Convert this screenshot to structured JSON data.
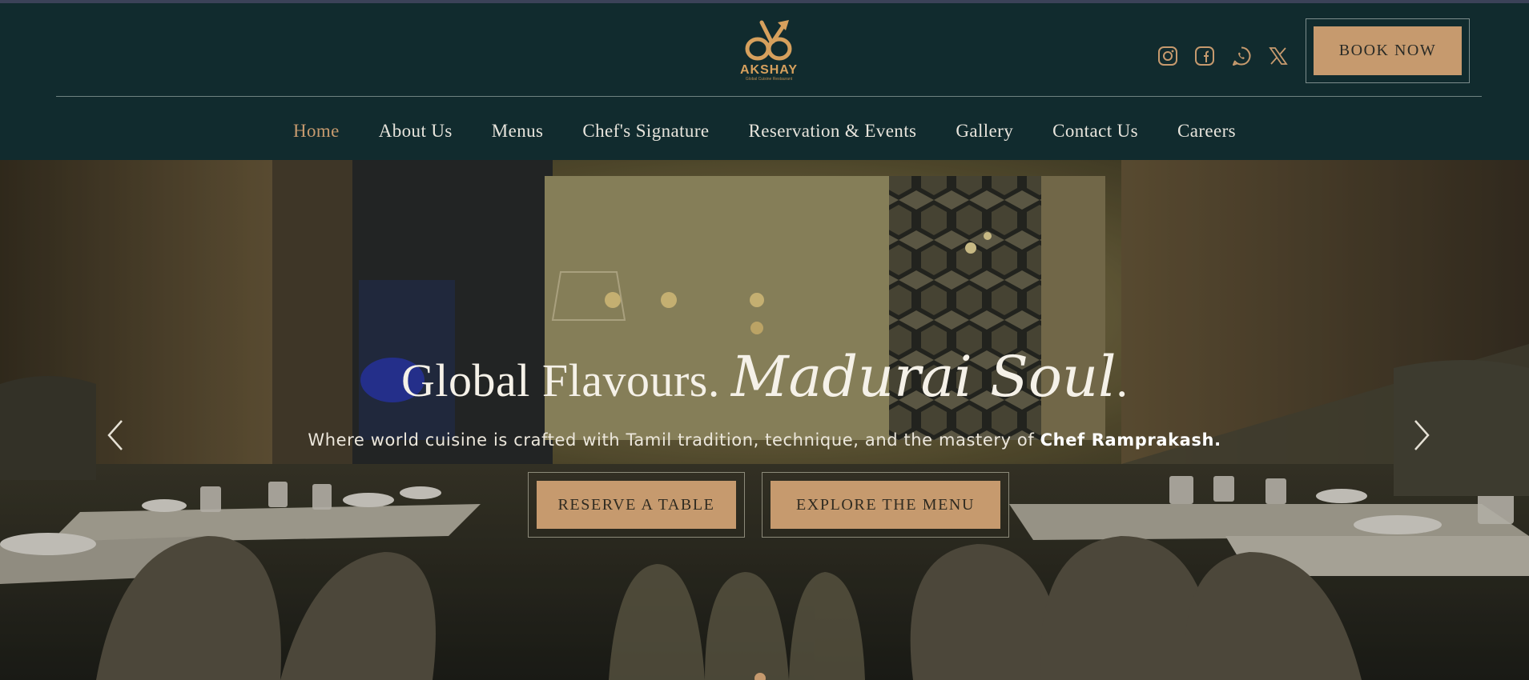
{
  "brand": {
    "name": "AKSHAY",
    "tagline": "Global Cuisine Restaurant",
    "accent_color": "#c69a6e",
    "header_bg": "#112b2e"
  },
  "socials": [
    {
      "name": "instagram-icon"
    },
    {
      "name": "facebook-icon"
    },
    {
      "name": "whatsapp-icon"
    },
    {
      "name": "x-icon"
    }
  ],
  "header": {
    "book_label": "BOOK NOW"
  },
  "nav": {
    "items": [
      {
        "label": "Home",
        "active": true
      },
      {
        "label": "About Us"
      },
      {
        "label": "Menus"
      },
      {
        "label": "Chef's Signature"
      },
      {
        "label": "Reservation & Events"
      },
      {
        "label": "Gallery"
      },
      {
        "label": "Contact Us"
      },
      {
        "label": "Careers"
      }
    ]
  },
  "hero": {
    "title_plain": "Global Flavours.",
    "title_script": "Madurai Soul",
    "title_end": ".",
    "subtitle_lead": "Where world cuisine is crafted with Tamil tradition, technique, and the mastery of",
    "subtitle_bold": "Chef Ramprakash.",
    "reserve_label": "RESERVE A TABLE",
    "menu_label": "EXPLORE THE MENU"
  }
}
